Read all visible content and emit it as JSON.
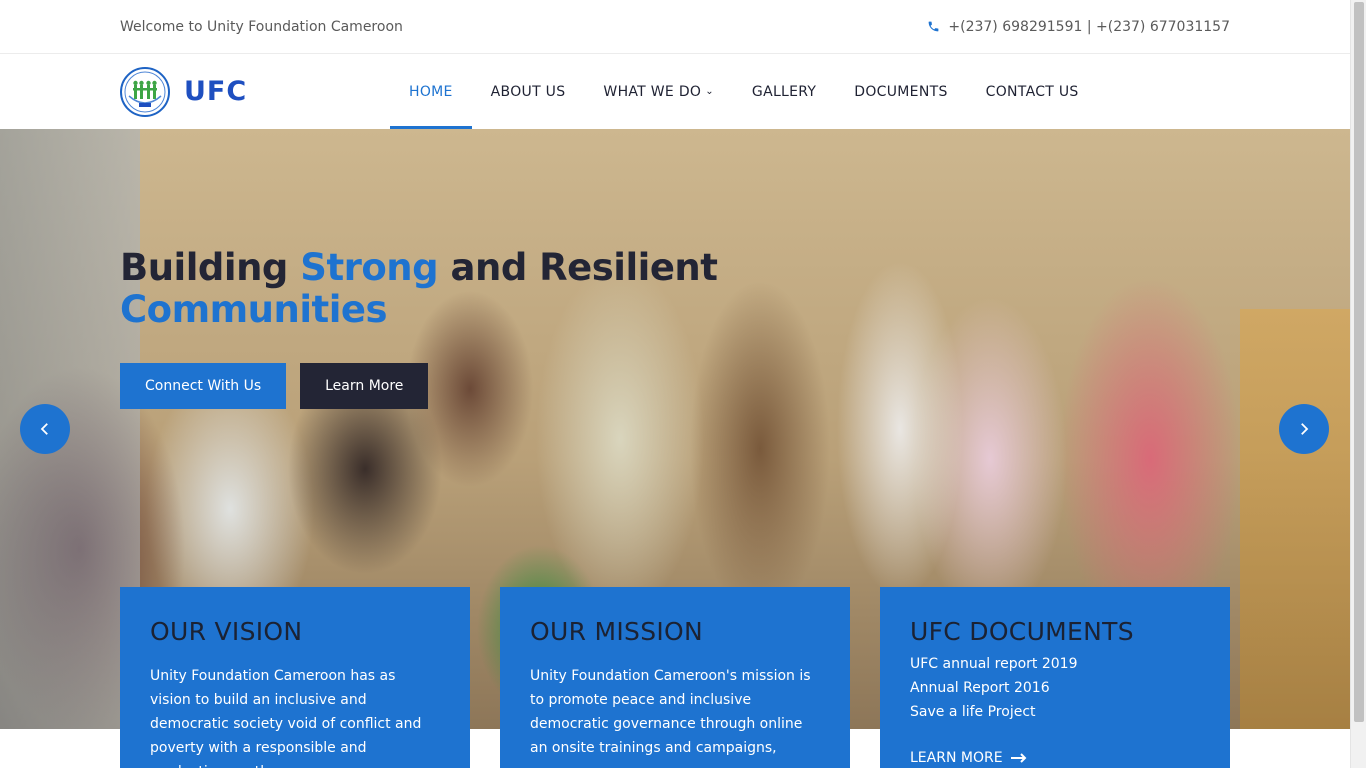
{
  "topbar": {
    "welcome": "Welcome to Unity Foundation Cameroon",
    "phone": "+(237) 698291591 | +(237) 677031157"
  },
  "header": {
    "brand": "UFC",
    "nav": {
      "home": "HOME",
      "about": "ABOUT US",
      "what_we_do": "WHAT WE DO",
      "gallery": "GALLERY",
      "documents": "DOCUMENTS",
      "contact": "CONTACT US"
    }
  },
  "hero": {
    "title_part1": "Building ",
    "title_highlight1": "Strong",
    "title_part2": " and Resilient",
    "title_highlight2": "Communities",
    "connect_label": "Connect With Us",
    "learn_label": "Learn More"
  },
  "cards": {
    "vision": {
      "title": "OUR VISION",
      "text": "Unity Foundation Cameroon has as vision to build an inclusive and democratic society void of conflict and poverty with a responsible and productive youth"
    },
    "mission": {
      "title": "OUR MISSION",
      "text": "Unity Foundation Cameroon's mission is to promote peace and inclusive democratic governance through online an onsite trainings and campaigns,"
    },
    "documents": {
      "title": "UFC DOCUMENTS",
      "items": [
        "UFC annual report 2019",
        "Annual Report 2016",
        "Save a life Project"
      ],
      "learn_more": "LEARN MORE"
    }
  },
  "colors": {
    "accent": "#1e73d0",
    "dark": "#232535"
  },
  "icons": {
    "phone": "phone-icon",
    "prev": "chevron-left-icon",
    "next": "chevron-right-icon",
    "dropdown": "chevron-down-icon",
    "arrow": "arrow-right-icon"
  }
}
